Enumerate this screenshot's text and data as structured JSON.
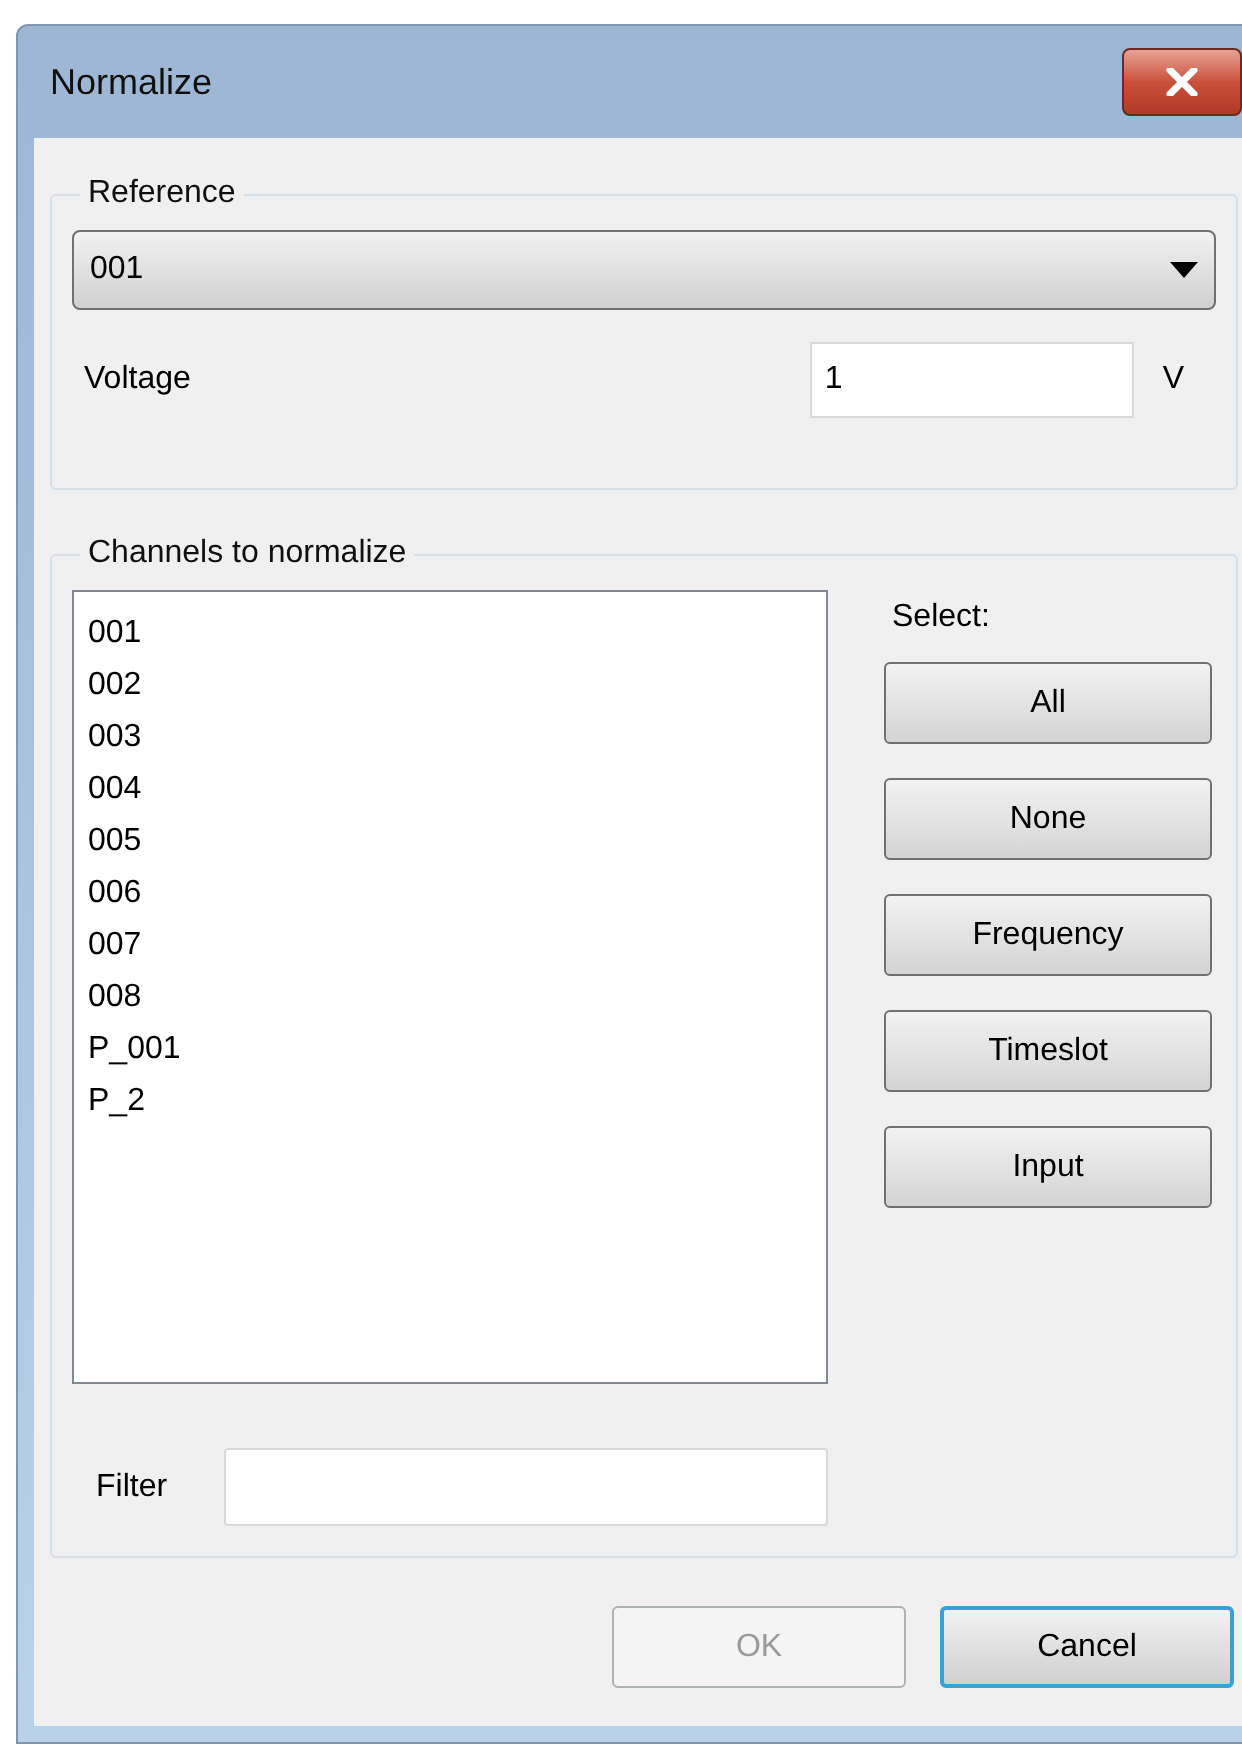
{
  "window": {
    "title": "Normalize"
  },
  "reference": {
    "label": "Reference",
    "selected_value": "001",
    "voltage_label": "Voltage",
    "voltage_value": "1",
    "unit": "V"
  },
  "channels": {
    "label": "Channels to normalize",
    "items": [
      "001",
      "002",
      "003",
      "004",
      "005",
      "006",
      "007",
      "008",
      "P_001",
      "P_2"
    ],
    "select_label": "Select:",
    "select_buttons": [
      "All",
      "None",
      "Frequency",
      "Timeslot",
      "Input"
    ],
    "filter_label": "Filter"
  },
  "buttons": [
    {
      "label": "OK",
      "disabled": true,
      "focused": false
    },
    {
      "label": "Cancel",
      "disabled": false,
      "focused": true
    }
  ]
}
